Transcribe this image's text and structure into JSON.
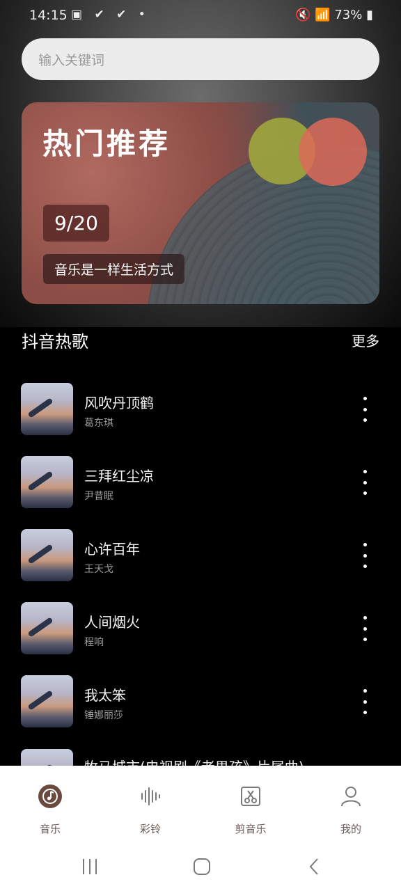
{
  "status_bar": {
    "time": "14:15",
    "battery": "73%"
  },
  "search": {
    "placeholder": "输入关键词"
  },
  "banner": {
    "title": "热门推荐",
    "counter": "9/20",
    "caption": "音乐是一样生活方式"
  },
  "section": {
    "title": "抖音热歌",
    "more": "更多"
  },
  "songs": [
    {
      "title": "风吹丹顶鹤",
      "artist": "葛东琪"
    },
    {
      "title": "三拜红尘凉",
      "artist": "尹昔眠"
    },
    {
      "title": "心许百年",
      "artist": "王天戈"
    },
    {
      "title": "人间烟火",
      "artist": "程响"
    },
    {
      "title": "我太笨",
      "artist": "锤娜丽莎"
    },
    {
      "title": "牧马城市(电视剧《老男孩》片尾曲)",
      "artist": ""
    }
  ],
  "bottom_nav": {
    "items": [
      {
        "label": "音乐",
        "icon": "music-icon",
        "active": true
      },
      {
        "label": "彩铃",
        "icon": "soundwave-icon",
        "active": false
      },
      {
        "label": "剪音乐",
        "icon": "scissors-icon",
        "active": false
      },
      {
        "label": "我的",
        "icon": "person-icon",
        "active": false
      }
    ]
  },
  "colors": {
    "accent": "#6a4a3f",
    "nav_inactive": "#8a8a8a",
    "background": "#000000"
  }
}
